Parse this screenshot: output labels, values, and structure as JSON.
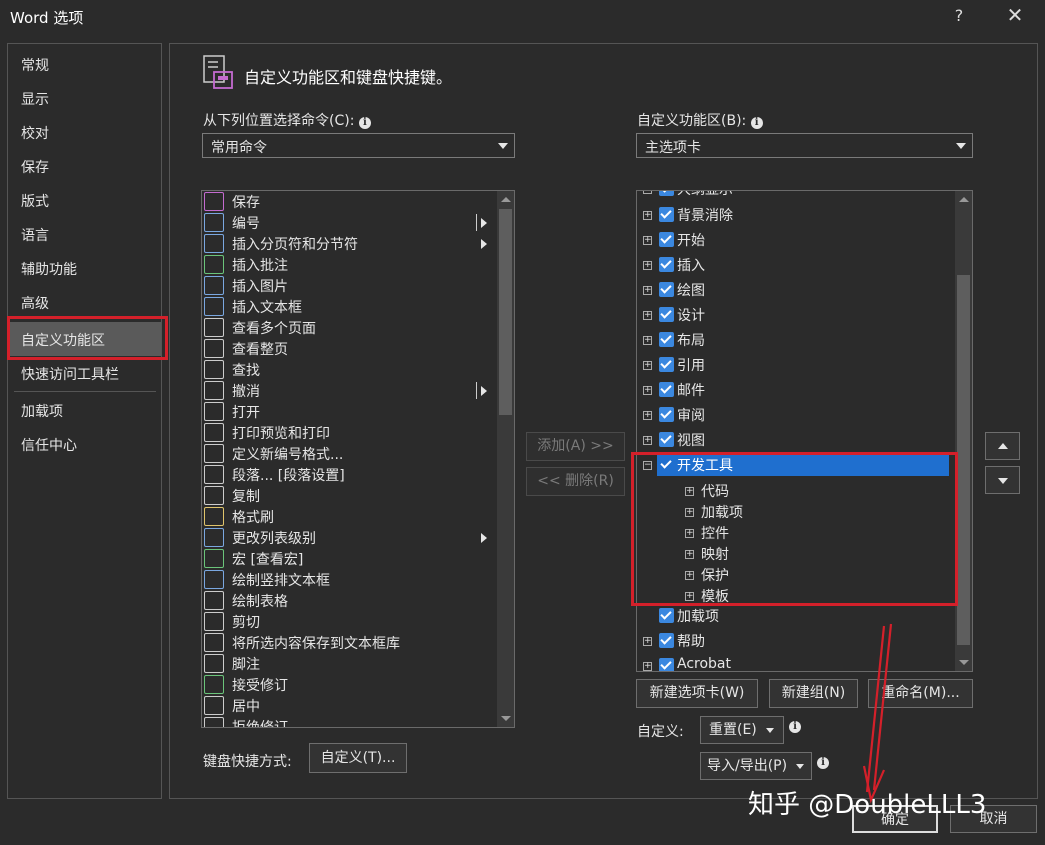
{
  "window": {
    "title": "Word 选项",
    "help": "?",
    "close": "✕"
  },
  "nav": {
    "items": [
      "常规",
      "显示",
      "校对",
      "保存",
      "版式",
      "语言",
      "辅助功能",
      "高级",
      "自定义功能区",
      "快速访问工具栏",
      "加载项",
      "信任中心"
    ]
  },
  "header": {
    "title": "自定义功能区和键盘快捷键。"
  },
  "left_panel": {
    "choose_label": "从下列位置选择命令(C):",
    "choose_value": "常用命令",
    "commands": [
      {
        "label": "保存",
        "sub": false
      },
      {
        "label": "编号",
        "sub": true
      },
      {
        "label": "插入分页符和分节符",
        "sub": true
      },
      {
        "label": "插入批注",
        "sub": false
      },
      {
        "label": "插入图片",
        "sub": false
      },
      {
        "label": "插入文本框",
        "sub": false
      },
      {
        "label": "查看多个页面",
        "sub": false
      },
      {
        "label": "查看整页",
        "sub": false
      },
      {
        "label": "查找",
        "sub": false
      },
      {
        "label": "撤消",
        "sub": true
      },
      {
        "label": "打开",
        "sub": false
      },
      {
        "label": "打印预览和打印",
        "sub": false
      },
      {
        "label": "定义新编号格式...",
        "sub": false
      },
      {
        "label": "段落... [段落设置]",
        "sub": false
      },
      {
        "label": "复制",
        "sub": false
      },
      {
        "label": "格式刷",
        "sub": false
      },
      {
        "label": "更改列表级别",
        "sub": true
      },
      {
        "label": "宏 [查看宏]",
        "sub": false
      },
      {
        "label": "绘制竖排文本框",
        "sub": false
      },
      {
        "label": "绘制表格",
        "sub": false
      },
      {
        "label": "剪切",
        "sub": false
      },
      {
        "label": "将所选内容保存到文本框库",
        "sub": false
      },
      {
        "label": "脚注",
        "sub": false
      },
      {
        "label": "接受修订",
        "sub": false
      },
      {
        "label": "居中",
        "sub": false
      },
      {
        "label": "拒绝修订",
        "sub": false
      }
    ],
    "keyboard_label": "键盘快捷方式:",
    "keyboard_button": "自定义(T)..."
  },
  "middle": {
    "add_button": "添加(A) >>",
    "remove_button": "<< 删除(R)"
  },
  "right_panel": {
    "ribbon_label": "自定义功能区(B):",
    "ribbon_value": "主选项卡",
    "tabs_top_partial": "大纲显示",
    "tabs": [
      "背景消除",
      "开始",
      "插入",
      "绘图",
      "设计",
      "布局",
      "引用",
      "邮件",
      "审阅",
      "视图"
    ],
    "developer": {
      "label": "开发工具",
      "groups": [
        "代码",
        "加载项",
        "控件",
        "映射",
        "保护",
        "模板"
      ]
    },
    "tabs_after": [
      "加载项",
      "帮助",
      "Acrobat"
    ],
    "new_tab_button": "新建选项卡(W)",
    "new_group_button": "新建组(N)",
    "rename_button": "重命名(M)...",
    "customize_label": "自定义:",
    "reset_button": "重置(E)",
    "import_export_button": "导入/导出(P)"
  },
  "footer": {
    "ok": "确定",
    "cancel": "取消"
  },
  "watermark": "知乎 @DoubleLLL3",
  "colors": {
    "accent": "#3b88e0",
    "highlight_red": "#d4202a",
    "selected_row": "#1f6fcf"
  }
}
